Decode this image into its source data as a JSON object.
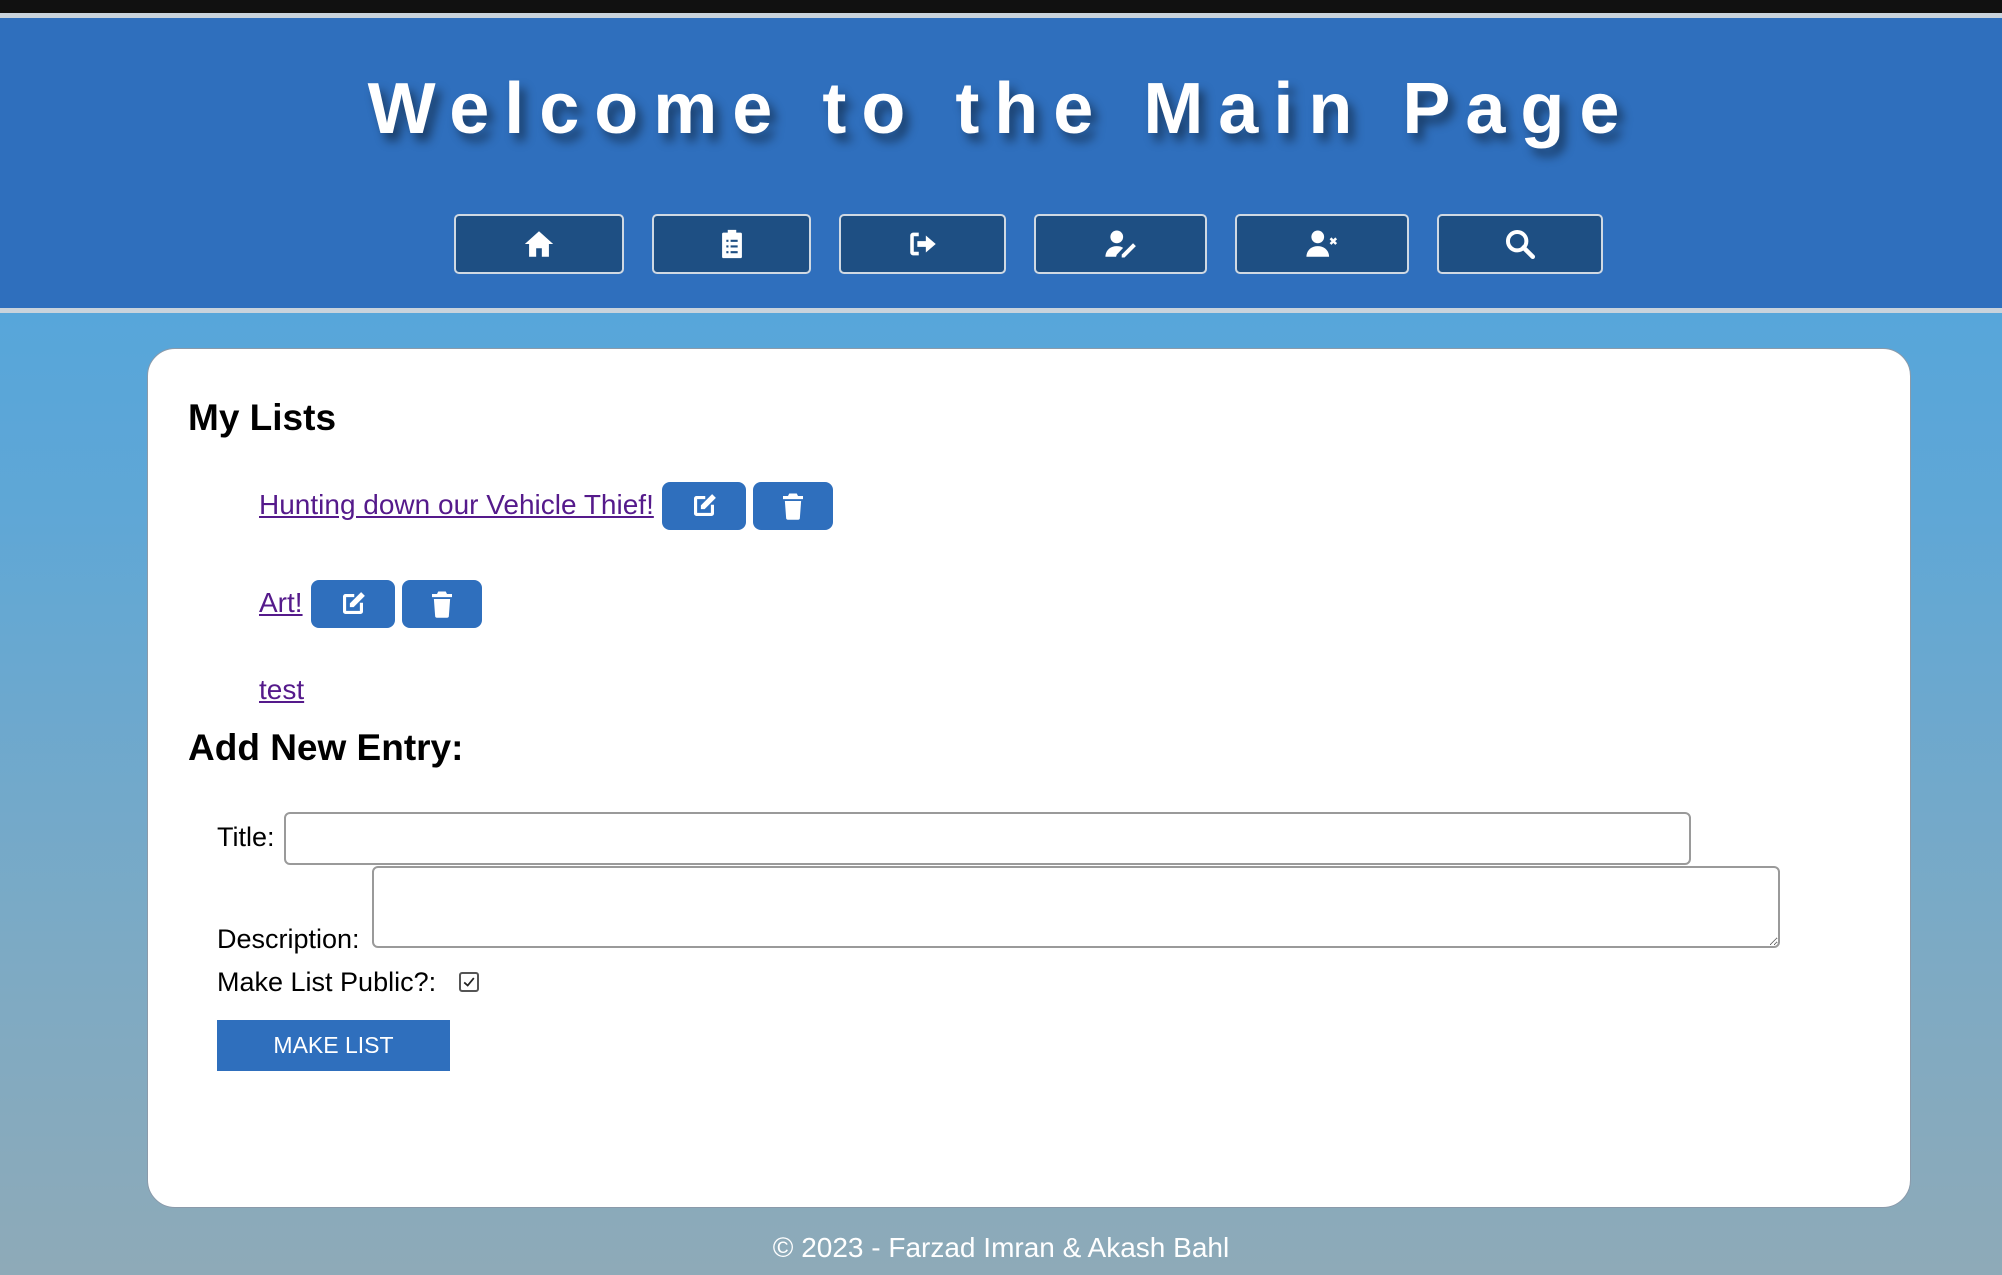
{
  "header": {
    "title": "Welcome to the Main Page",
    "nav": [
      {
        "icon": "home-icon"
      },
      {
        "icon": "clipboard-list-icon"
      },
      {
        "icon": "sign-out-icon"
      },
      {
        "icon": "user-edit-icon"
      },
      {
        "icon": "user-remove-icon"
      },
      {
        "icon": "search-icon"
      }
    ]
  },
  "lists": {
    "heading": "My Lists",
    "items": [
      {
        "title": "Hunting down our Vehicle Thief!",
        "editable": true
      },
      {
        "title": "Art!",
        "editable": true
      },
      {
        "title": "test",
        "editable": false
      }
    ]
  },
  "form": {
    "heading": "Add New Entry:",
    "title_label": "Title:",
    "title_value": "",
    "description_label": "Description:",
    "description_value": "",
    "public_label": "Make List Public?:",
    "public_checked": true,
    "submit_label": "MAKE LIST"
  },
  "footer": {
    "text": "© 2023 - Farzad Imran & Akash Bahl"
  },
  "colors": {
    "header_bg": "#2f6fbd",
    "nav_button_bg": "#1e4f83",
    "accent": "#2f6fbd",
    "link": "#551a8b"
  }
}
